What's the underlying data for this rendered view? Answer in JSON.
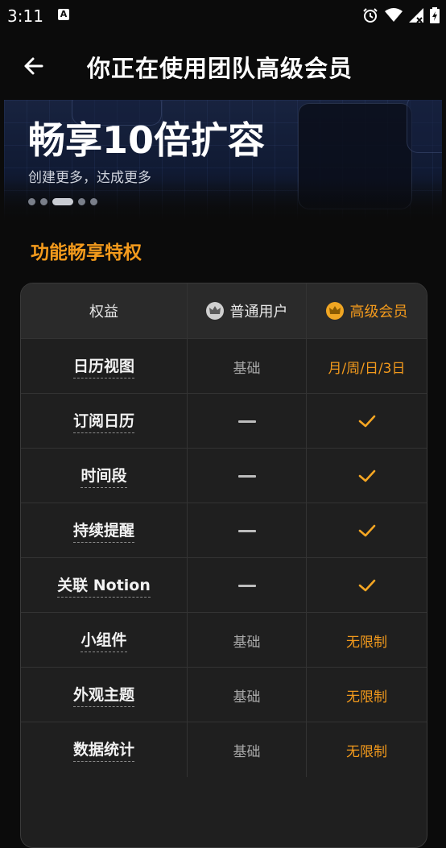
{
  "status_bar": {
    "time": "3:11",
    "icons": [
      "a-notification-icon",
      "alarm-icon",
      "wifi-icon",
      "signal-icon",
      "battery-icon"
    ],
    "notification_letter": "A"
  },
  "app_bar": {
    "title": "你正在使用团队高级会员",
    "back_icon": "arrow-left-icon"
  },
  "banner": {
    "headline": "畅享10倍扩容",
    "subtitle": "创建更多，达成更多",
    "dot_count": 5,
    "active_dot": 2
  },
  "section": {
    "title": "功能畅享特权"
  },
  "table": {
    "headers": {
      "feature": "权益",
      "normal": "普通用户",
      "premium": "高级会员"
    },
    "rows": [
      {
        "feature": "日历视图",
        "normal": "基础",
        "premium": "月/周/日/3日"
      },
      {
        "feature": "订阅日历",
        "normal": "—",
        "premium": "✓"
      },
      {
        "feature": "时间段",
        "normal": "—",
        "premium": "✓"
      },
      {
        "feature": "持续提醒",
        "normal": "—",
        "premium": "✓"
      },
      {
        "feature": "关联 Notion",
        "normal": "—",
        "premium": "✓"
      },
      {
        "feature": "小组件",
        "normal": "基础",
        "premium": "无限制"
      },
      {
        "feature": "外观主题",
        "normal": "基础",
        "premium": "无限制"
      },
      {
        "feature": "数据统计",
        "normal": "基础",
        "premium": "无限制"
      }
    ]
  },
  "colors": {
    "accent": "#f39a1c",
    "background": "#0b0b0b",
    "table_bg": "#1f1f1f"
  }
}
